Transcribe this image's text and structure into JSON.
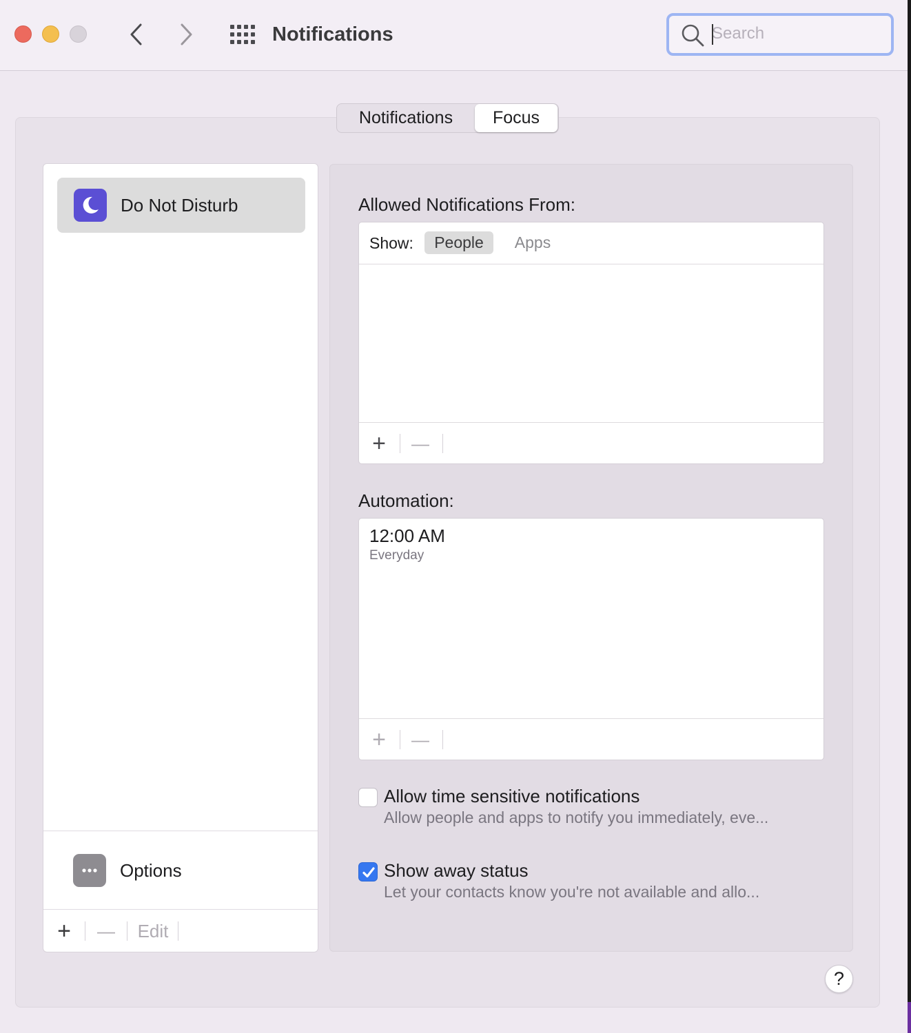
{
  "window": {
    "title": "Notifications",
    "search": {
      "placeholder": "Search",
      "value": ""
    }
  },
  "tabs": [
    {
      "label": "Notifications",
      "selected": false
    },
    {
      "label": "Focus",
      "selected": true
    }
  ],
  "focus_list": {
    "items": [
      {
        "label": "Do Not Disturb",
        "icon": "moon-icon",
        "selected": true
      }
    ],
    "options": {
      "label": "Options",
      "icon": "ellipsis-icon"
    },
    "toolbar": {
      "add": "+",
      "remove": "—",
      "edit": "Edit"
    }
  },
  "allowed": {
    "heading": "Allowed Notifications From:",
    "show_label": "Show:",
    "filters": [
      {
        "label": "People",
        "selected": true
      },
      {
        "label": "Apps",
        "selected": false
      }
    ],
    "toolbar": {
      "add": "+",
      "remove": "—"
    }
  },
  "automation": {
    "heading": "Automation:",
    "items": [
      {
        "time": "12:00 AM",
        "repeat": "Everyday"
      }
    ],
    "toolbar": {
      "add": "+",
      "remove": "—"
    }
  },
  "options": {
    "time_sensitive": {
      "title": "Allow time sensitive notifications",
      "description": "Allow people and apps to notify you immediately, eve...",
      "checked": false
    },
    "away_status": {
      "title": "Show away status",
      "description": "Let your contacts know you're not available and allo...",
      "checked": true
    }
  },
  "help": {
    "label": "?"
  },
  "colors": {
    "accent": "#3577f0",
    "focus_icon": "#5b4fd4",
    "search_ring": "#9db5f3"
  }
}
